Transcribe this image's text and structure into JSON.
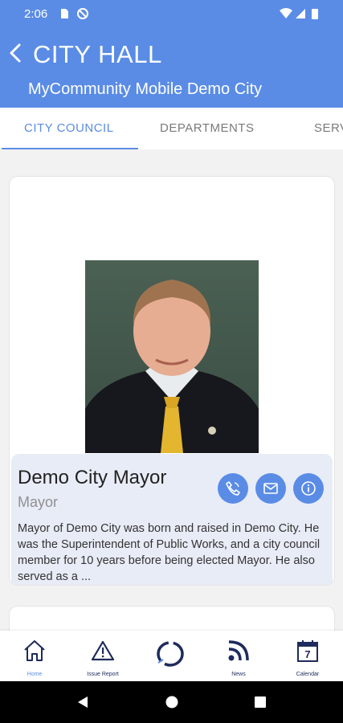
{
  "status_bar": {
    "time": "2:06"
  },
  "header": {
    "title": "CITY HALL",
    "subtitle": "MyCommunity Mobile Demo City"
  },
  "tabs": [
    {
      "label": "CITY COUNCIL",
      "active": true
    },
    {
      "label": "DEPARTMENTS",
      "active": false
    },
    {
      "label": "SERV",
      "active": false
    }
  ],
  "member": {
    "name": "Demo City Mayor",
    "role": "Mayor",
    "bio": "Mayor of Demo City was born and raised in Demo City. He was the Superintendent of Public Works, and a city council member for 10 years before being elected Mayor. He also served as a ..."
  },
  "bottom_nav": [
    {
      "label": "Home",
      "icon": "home-icon",
      "active": true
    },
    {
      "label": "Issue Report",
      "icon": "warning-icon",
      "active": false
    },
    {
      "label": "",
      "icon": "app-logo-icon",
      "active": false
    },
    {
      "label": "News",
      "icon": "rss-icon",
      "active": false
    },
    {
      "label": "Calendar",
      "icon": "calendar-icon",
      "calendar_day": "7",
      "active": false
    }
  ],
  "colors": {
    "accent": "#5a8ce6",
    "nav_dark": "#1e2b5c"
  }
}
